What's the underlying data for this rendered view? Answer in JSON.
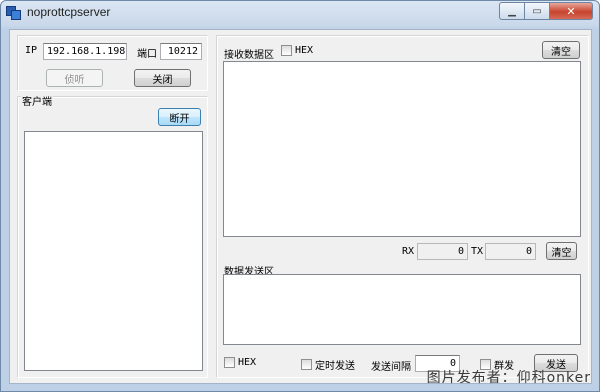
{
  "window": {
    "title": "noprottcpserver"
  },
  "connection": {
    "ip_label": "IP",
    "ip_value": "192.168.1.198",
    "port_label": "端口",
    "port_value": "10212",
    "listen_label": "侦听",
    "close_label": "关闭"
  },
  "clients": {
    "label": "客户端",
    "disconnect_label": "断开"
  },
  "receive": {
    "label": "接收数据区",
    "hex_label": "HEX",
    "clear_label": "清空"
  },
  "counters": {
    "rx_label": "RX",
    "rx_value": "0",
    "tx_label": "TX",
    "tx_value": "0",
    "clear_label": "清空"
  },
  "send": {
    "label": "数据发送区",
    "hex_label": "HEX",
    "timed_label": "定时发送",
    "interval_label": "发送间隔",
    "interval_value": "0",
    "broadcast_label": "群发",
    "send_label": "发送"
  },
  "watermark": "图片发布者：仰科onker"
}
